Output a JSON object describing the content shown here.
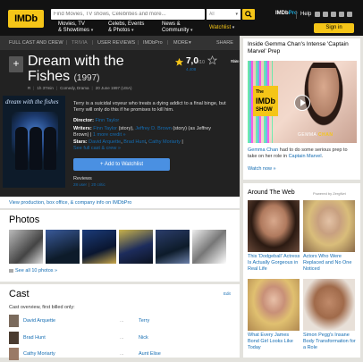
{
  "header": {
    "logo": "IMDb",
    "search_placeholder": "Find Movies, TV shows, Celebrities and more...",
    "search_category": "All",
    "imdbpro_prefix": "IMDb",
    "imdbpro_suffix": "Pro",
    "help": "Help",
    "signin": "Sign in",
    "menu": [
      {
        "line1": "Movies, TV",
        "line2": "& Showtimes"
      },
      {
        "line1": "Celebs, Events",
        "line2": "& Photos"
      },
      {
        "line1": "News &",
        "line2": "Community"
      },
      {
        "line1": "Watchlist",
        "line2": ""
      }
    ]
  },
  "subnav": {
    "items": [
      "FULL CAST AND CREW",
      "TRIVIA",
      "USER REVIEWS",
      "IMDbPro",
      "MORE",
      "SHARE"
    ]
  },
  "movie": {
    "title_line1": "Dream with the",
    "title_line2": "Fishes",
    "year": "(1997)",
    "rating_badge": "R",
    "runtime": "1h 37min",
    "genres": "Comedy, Drama",
    "release": "20 June 1997 (USA)",
    "rating": "7,0",
    "rating_max": "/10",
    "rating_count": "4,408",
    "rate_this_line1": "Rate",
    "rate_this_line2": "This",
    "poster_title": "dream with the fishes",
    "plot": "Terry is a suicidal voyeur who treats a dying addict to a final binge, but Terry will only do this if he promises to kill him.",
    "director_label": "Director:",
    "director": "Finn Taylor",
    "writers_label": "Writers:",
    "writers_1": "Finn Taylor",
    "writers_1_note": "(story),",
    "writers_2": "Jeffrey D. Brown",
    "writers_2_note": "(story) (as Jeffrey",
    "writers_3": "Brown) |",
    "writers_more": "1 more credit »",
    "stars_label": "Stars:",
    "stars": [
      "David Arquette",
      "Brad Hunt",
      "Cathy Moriarty"
    ],
    "stars_more": "See full cast & crew »",
    "watchlist_btn": "+ Add to Watchlist",
    "reviews_label": "Reviews",
    "reviews_user": "28 user",
    "reviews_critic": "20 critic"
  },
  "production_link": "View production, box office, & company info on IMDbPro",
  "photos": {
    "title": "Photos",
    "see_all": "See all 10 photos »"
  },
  "cast": {
    "title": "Cast",
    "edit": "Edit",
    "subtitle": "Cast overview, first billed only:",
    "rows": [
      {
        "actor": "David Arquette",
        "dots": "...",
        "role": "Terry"
      },
      {
        "actor": "Brad Hunt",
        "dots": "...",
        "role": "Nick"
      },
      {
        "actor": "Cathy Moriarty",
        "dots": "...",
        "role": "Aunt Elise"
      }
    ]
  },
  "sidebar": {
    "promo_title": "Inside Gemma Chan's Intense 'Captain Marvel' Prep",
    "promo_show_line1": "The",
    "promo_show_line2": "IMDb",
    "promo_show_line3": "SHOW",
    "promo_name_first": "GEMMA",
    "promo_name_last": "CHAN",
    "promo_desc_link1": "Gemma Chan",
    "promo_desc_mid": " had to do some serious prep to take on her role in ",
    "promo_desc_link2": "Captain Marvel",
    "promo_desc_end": ".",
    "watch_now": "Watch now »",
    "around_title": "Around The Web",
    "powered_by": "Powered by ZergNet",
    "ads": [
      "This 'Dodgeball' Actress Is Actually Gorgeous in Real Life",
      "Actors Who Were Replaced and No One Noticed",
      "What Every James Bond Girl Looks Like Today",
      "Simon Pegg's Insane Body Transformation for a Role"
    ]
  },
  "colors": {
    "brand_yellow": "#f5c518",
    "link_blue": "#136cb2",
    "button_blue": "#4a90e2",
    "dark_bg": "#222222"
  }
}
